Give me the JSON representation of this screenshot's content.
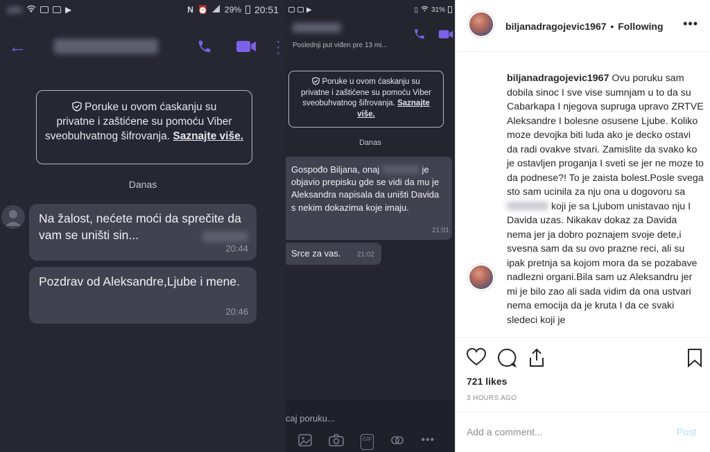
{
  "left_screen": {
    "status_time": "20:51",
    "battery": "29%",
    "notice_line1": "Poruke u ovom ćaskanju su",
    "notice_line2": "privatne i zaštićene su pomoću Viber",
    "notice_line3": "sveobuhvatnog šifrovanja.",
    "notice_link": "Saznajte više.",
    "date_label": "Danas",
    "messages": [
      {
        "text": "Na žalost, nećete moći da sprečite da vam se uništi sin...",
        "time": "20:44"
      },
      {
        "text": "Pozdrav od Aleksandre,Ljube i mene.",
        "time": "20:46"
      }
    ]
  },
  "middle_screen": {
    "battery": "31%",
    "last_seen": "Poslednji put viđen pre 13 mi...",
    "notice_line1": "Poruke u ovom ćaskanju su",
    "notice_line2": "privatne i zaštićene su pomoću Viber",
    "notice_line3": "sveobuhvatnog šifrovanja.",
    "notice_link": "Saznajte više.",
    "date_label": "Danas",
    "msg1_part1": "Gospođo Biljana, onaj",
    "msg1_part2": "je objavio prepisku gde se vidi da mu je Aleksandra napisala da uništi Davida s nekim dokazima koje imaju.",
    "msg1_time": "21:01",
    "msg2_text": "Srce za vas.",
    "msg2_time": "21:02",
    "composer_placeholder": "caj poruku..."
  },
  "instagram": {
    "username": "biljanadragojevic1967",
    "separator": "•",
    "follow_status": "Following",
    "caption_part1": "Ovu poruku sam dobila sinoc I sve vise sumnjam u to da su Cabarkapa I njegova supruga upravo ZRTVE Aleksandre I bolesne osusene Ljube. Koliko moze devojka biti luda ako je decko ostavi da radi ovakve stvari. Zamislite da svako ko je ostavljen proganja I sveti se jer ne moze to da podnese?! To je zaista bolest.Posle svega sto sam ucinila za nju ona u dogovoru sa",
    "caption_part2": "koji je sa Ljubom unistavao nju I Davida uzas. Nikakav dokaz za Davida nema jer ja dobro poznajem svoje dete,i svesna sam da su ovo prazne reci, ali su ipak pretnja sa kojom mora da se pozabave nadlezni organi.Bila sam uz Aleksandru jer mi je bilo zao ali sada vidim da ona ustvari nema emocija da je kruta I da ce svaki sledeci koji je",
    "likes": "721 likes",
    "time_ago": "3 HOURS AGO",
    "comment_placeholder": "Add a comment...",
    "post_label": "Post",
    "colors": {
      "link_blue": "#b3dbff",
      "viber_purple": "#7b62e6"
    }
  }
}
